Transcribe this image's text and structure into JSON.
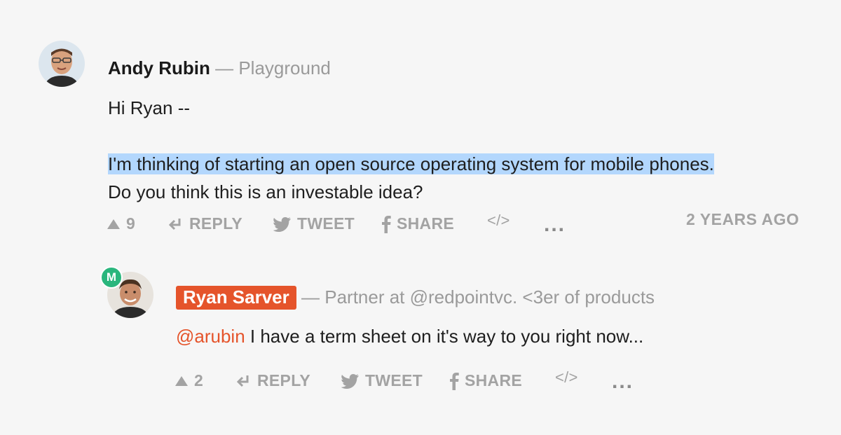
{
  "thread": {
    "parent": {
      "author": "Andy Rubin",
      "separator": "—",
      "tagline": "Playground",
      "greeting": "Hi Ryan --",
      "highlighted_text": "I'm thinking of starting an open source operating system for mobile phones.",
      "text_line2": "Do you think this is an investable idea?",
      "upvotes": "9",
      "reply_label": "REPLY",
      "tweet_label": "TWEET",
      "share_label": "SHARE",
      "embed_label": "</>",
      "more_label": "...",
      "timestamp": "2 YEARS AGO",
      "avatar_icon": "avatar-photo-icon"
    },
    "reply": {
      "badge_letter": "M",
      "author": "Ryan Sarver",
      "separator": "—",
      "tagline": "Partner at @redpointvc. <3er of products",
      "mention": "@arubin",
      "text": " I have a term sheet on it's way to you right now...",
      "upvotes": "2",
      "reply_label": "REPLY",
      "tweet_label": "TWEET",
      "share_label": "SHARE",
      "embed_label": "</>",
      "more_label": "...",
      "avatar_icon": "avatar-photo-icon"
    }
  },
  "colors": {
    "background": "#f6f6f6",
    "accent": "#e5542b",
    "highlight": "#b3d7fd",
    "muted": "#a3a3a3",
    "badge": "#2ab67d"
  }
}
